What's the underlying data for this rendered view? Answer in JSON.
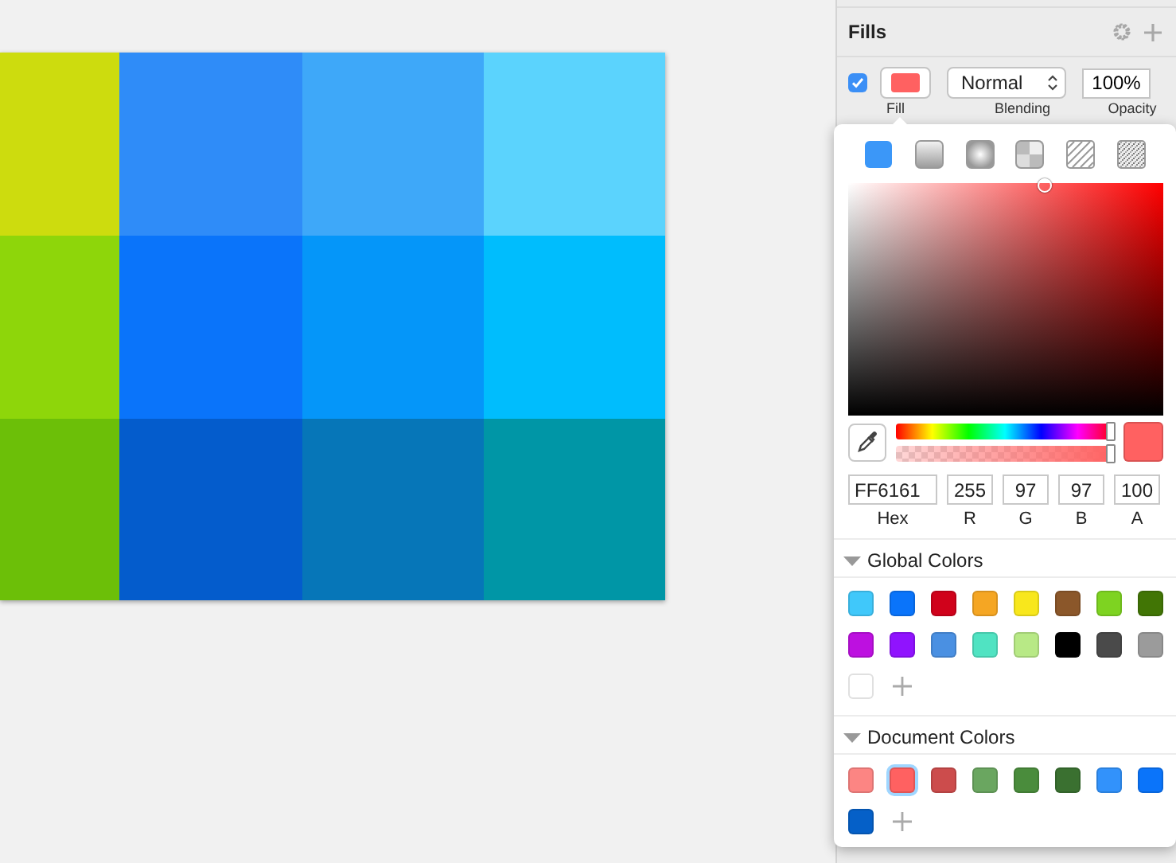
{
  "canvas": {
    "tiles": [
      {
        "color": "#cddc0e"
      },
      {
        "color": "#2f8cf8"
      },
      {
        "color": "#3ea8f9"
      },
      {
        "color": "#5bd3fd"
      },
      {
        "color": "#8ed60a"
      },
      {
        "color": "#0a74fa"
      },
      {
        "color": "#0596f9"
      },
      {
        "color": "#00bdfd"
      },
      {
        "color": "#6cbf08"
      },
      {
        "color": "#045ccc"
      },
      {
        "color": "#0676b8"
      },
      {
        "color": "#0096a6"
      }
    ]
  },
  "inspector": {
    "section_title": "Fills",
    "fill": {
      "enabled": true,
      "color": "#ff6161",
      "blending": "Normal",
      "opacity": "100%"
    },
    "labels": [
      "Fill",
      "Blending",
      "Opacity"
    ]
  },
  "color_picker": {
    "fill_types": [
      {
        "kind": "solid",
        "selected": true
      },
      {
        "kind": "linear",
        "selected": false
      },
      {
        "kind": "radial",
        "selected": false
      },
      {
        "kind": "angular",
        "selected": false
      },
      {
        "kind": "pattern",
        "selected": false
      },
      {
        "kind": "noise",
        "selected": false
      }
    ],
    "hue_slider": {
      "level": 1
    },
    "alpha_slider": {
      "level": 1
    },
    "fields": [
      {
        "kind": "hex",
        "label": "Hex",
        "value": "FF6161"
      },
      {
        "kind": "channel",
        "label": "R",
        "value": "255"
      },
      {
        "kind": "channel",
        "label": "G",
        "value": "97"
      },
      {
        "kind": "channel",
        "label": "B",
        "value": "97"
      },
      {
        "kind": "channel",
        "label": "A",
        "value": "100"
      }
    ],
    "global_colors": {
      "title": "Global Colors",
      "expanded": true,
      "swatches": [
        {
          "color": "#40c8fa",
          "selected": false
        },
        {
          "color": "#0a74fa",
          "selected": false
        },
        {
          "color": "#d0021b",
          "selected": false
        },
        {
          "color": "#f5a623",
          "selected": false
        },
        {
          "color": "#f8e71c",
          "selected": false
        },
        {
          "color": "#8b572a",
          "selected": false
        },
        {
          "color": "#7ed321",
          "selected": false
        },
        {
          "color": "#417505",
          "selected": false
        },
        {
          "color": "#bd10e0",
          "selected": false
        },
        {
          "color": "#9013fe",
          "selected": false
        },
        {
          "color": "#4a90e2",
          "selected": false
        },
        {
          "color": "#50e3c2",
          "selected": false
        },
        {
          "color": "#b8e986",
          "selected": false
        },
        {
          "color": "#000000",
          "selected": false
        },
        {
          "color": "#4a4a4a",
          "selected": false
        },
        {
          "color": "#9b9b9b",
          "selected": false
        },
        {
          "color": "#ffffff",
          "selected": false
        }
      ]
    },
    "document_colors": {
      "title": "Document Colors",
      "expanded": true,
      "swatches": [
        {
          "color": "#fc8583",
          "selected": false
        },
        {
          "color": "#ff6161",
          "selected": true
        },
        {
          "color": "#cc4c4c",
          "selected": false
        },
        {
          "color": "#6aa660",
          "selected": false
        },
        {
          "color": "#4a8c3c",
          "selected": false
        },
        {
          "color": "#3a7030",
          "selected": false
        },
        {
          "color": "#3292fb",
          "selected": false
        },
        {
          "color": "#0a74fa",
          "selected": false
        },
        {
          "color": "#0560c8",
          "selected": false
        }
      ]
    }
  }
}
